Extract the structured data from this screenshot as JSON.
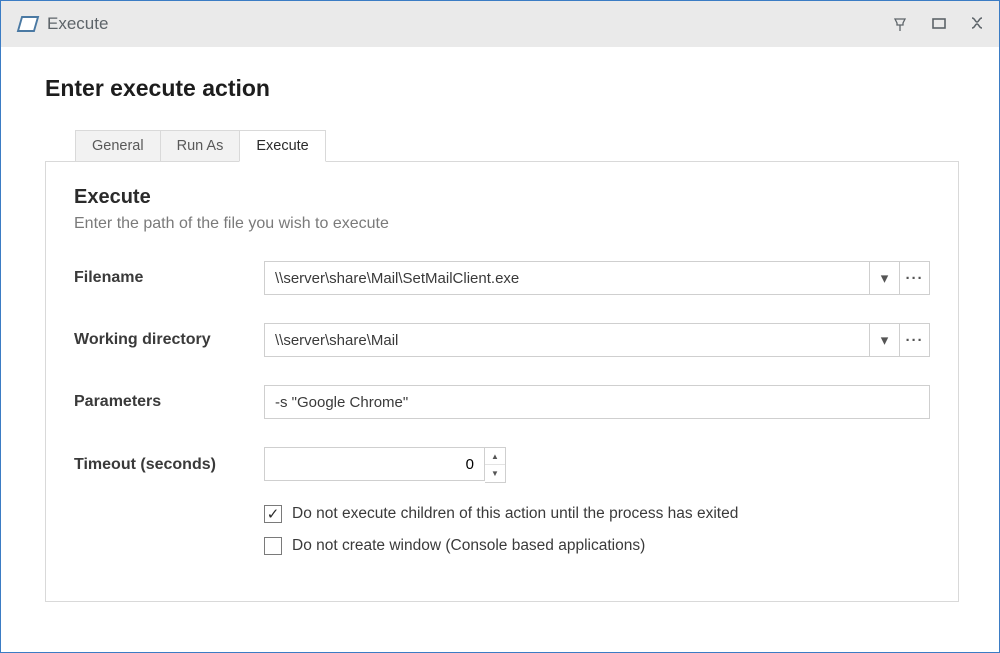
{
  "window": {
    "title": "Execute"
  },
  "heading": "Enter execute action",
  "tabs": [
    {
      "label": "General",
      "active": false
    },
    {
      "label": "Run As",
      "active": false
    },
    {
      "label": "Execute",
      "active": true
    }
  ],
  "panel": {
    "title": "Execute",
    "subtitle": "Enter the path of the file you wish to execute"
  },
  "fields": {
    "filename": {
      "label": "Filename",
      "value": "\\\\server\\share\\Mail\\SetMailClient.exe"
    },
    "workdir": {
      "label": "Working directory",
      "value": "\\\\server\\share\\Mail"
    },
    "params": {
      "label": "Parameters",
      "value": "-s \"Google Chrome\""
    },
    "timeout": {
      "label": "Timeout (seconds)",
      "value": "0"
    }
  },
  "checks": {
    "wait": {
      "label": "Do not execute children of this action until the process has exited",
      "checked": true
    },
    "nowin": {
      "label": "Do not create window (Console based applications)",
      "checked": false
    }
  }
}
